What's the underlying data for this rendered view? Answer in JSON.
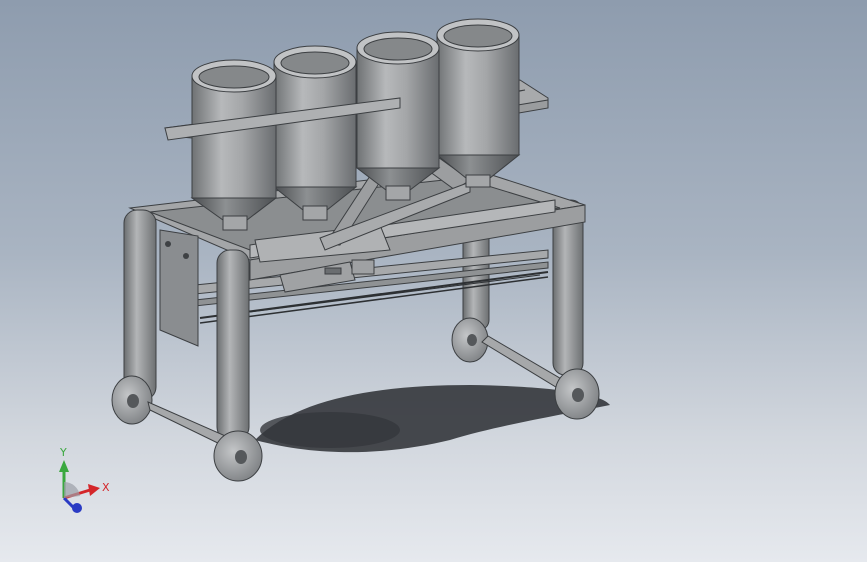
{
  "viewport": {
    "name": "cad-graphics-area",
    "background_top": "#8e9cae",
    "background_bottom": "#e6e9ee"
  },
  "model": {
    "description_icon": "hopper-cart-3d-model",
    "part_color": "#9ea0a2",
    "shadow_color": "#2b2e33",
    "hopper_count": 4,
    "wheel_count": 4
  },
  "triad": {
    "x_label": "X",
    "y_label": "Y",
    "x_color": "#d4262a",
    "y_color": "#3aa83f",
    "z_color": "#2a3bc4"
  }
}
